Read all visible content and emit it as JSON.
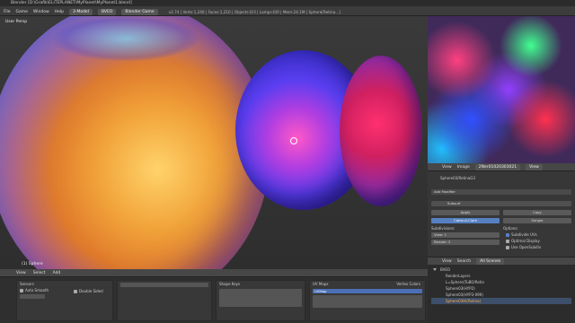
{
  "window": {
    "title": "Blender [D:\\Grafik\\ELITEPLANET\\MyPlanet\\MyPlanet1.blend]"
  },
  "menu": {
    "items": [
      "File",
      "Game",
      "Window",
      "Help"
    ],
    "layout": "3-Model",
    "scene": "BVEO",
    "engine": "Blender Game",
    "stats": "v2.74 | Verts:1,240 | Faces:1,210 | Objects:0/3 | Lamps:0/0 | Mem:24.1M | Sphere[Retina...]"
  },
  "viewport": {
    "mode_label": "User Persp",
    "object_label": "(1) Sphere",
    "header_items": [
      "View",
      "Select",
      "Add"
    ]
  },
  "logic": {
    "sensors": {
      "title": "Sensors",
      "check1": "Auto Smooth",
      "check2": "Double Sided"
    },
    "shape_keys": {
      "title": "Shape Keys"
    },
    "uv_maps": {
      "title": "UV Maps",
      "selected": "UVMap"
    },
    "vertex_colors": {
      "title": "Vertex Colors"
    }
  },
  "image_editor": {
    "header_items": [
      "View",
      "Image"
    ],
    "image_name": "2Ner01020303021",
    "view_label": "View"
  },
  "properties": {
    "object_name": "Sphere03/RetinaG3",
    "section": "Add Modifier",
    "modifier_name": "Subsurf",
    "apply_label": "Apply",
    "copy_label": "Copy",
    "catmull_label": "Catmull-Clark",
    "simple_label": "Simple",
    "subdiv_label": "Subdivisions:",
    "options_label": "Options:",
    "view_label": "View:",
    "render_label": "Render:",
    "view_value": "1",
    "render_value": "2",
    "opt1": "Subdivide UVs",
    "opt2": "Optimal Display",
    "opt3": "Use OpenSubdiv"
  },
  "outliner": {
    "header_items": [
      "View",
      "Search"
    ],
    "filter": "All Scenes",
    "rows": [
      "BVEO",
      "RenderLayers",
      "L=Sphere(TuBO/Retin",
      "Sphere03(HYP2)",
      "Sphere03(HYP3-099)",
      "Sphere03Hi(Retina)"
    ]
  }
}
